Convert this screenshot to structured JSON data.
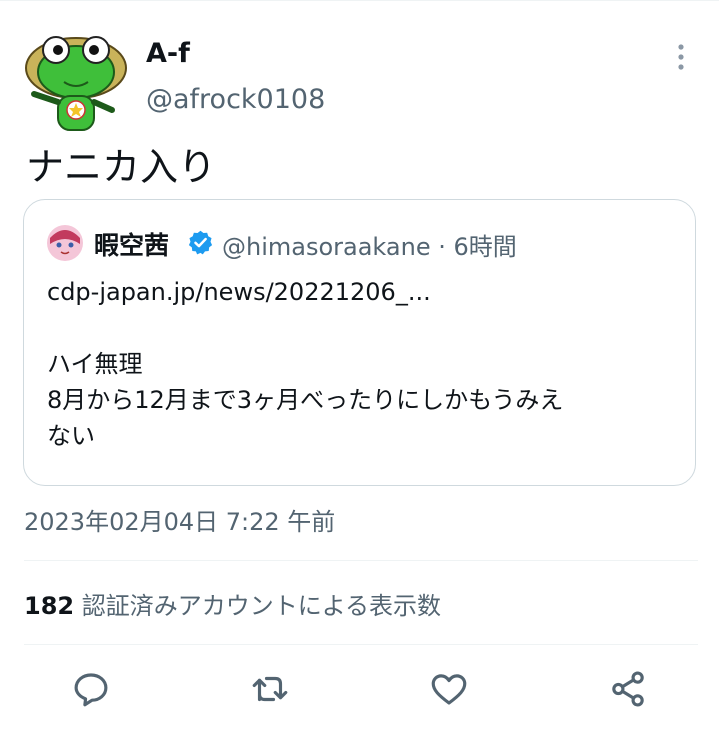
{
  "tweet": {
    "author_name": "A-f",
    "author_handle": "@afrock0108",
    "text": "ナニカ入り",
    "timestamp": "2023年02月04日 7:22 午前"
  },
  "quoted_tweet": {
    "author_name": "暇空茜",
    "handle_time": "@himasoraakane · 6時間",
    "lines": [
      "cdp-japan.jp/news/20221206_...",
      "",
      "ハイ無理",
      "8月から12月まで3ヶ月べったりにしかもうみえ",
      "ない"
    ]
  },
  "stats": {
    "view_count": "182",
    "view_label": "認証済みアカウントによる表示数"
  },
  "icons": [
    "more-vertical-icon",
    "verified-badge-icon",
    "reply-icon",
    "retweet-icon",
    "like-icon",
    "share-icon"
  ],
  "colors": {
    "accent": "#1d9bf0",
    "secondary_text": "#536471",
    "divider": "#eff3f4"
  }
}
